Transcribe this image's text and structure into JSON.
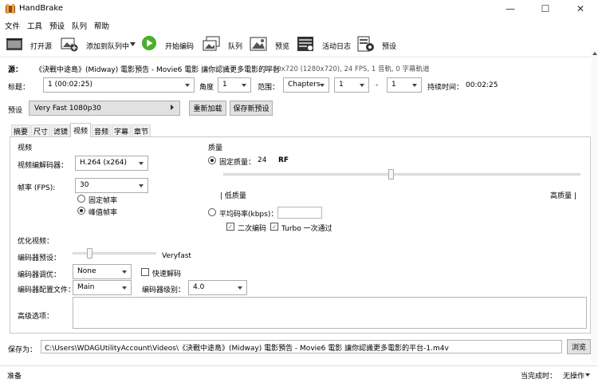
{
  "window": {
    "title": "HandBrake",
    "minimize": "—",
    "maximize": "☐",
    "close": "✕"
  },
  "menu": [
    "文件",
    "工具",
    "预设",
    "队列",
    "帮助"
  ],
  "toolbar": {
    "open": "打开源",
    "add_queue": "添加到队列中",
    "start": "开始编码",
    "queue": "队列",
    "preview": "预览",
    "activity": "活动日志",
    "presets": "预设"
  },
  "source": {
    "label": "源：",
    "name": "《決戰中途島》(Midway) 電影預告 - Movie6 電影 讓你認識更多電影的平台",
    "info": "1280x720 (1280x720), 24 FPS, 1 音軌, 0 字幕軌道"
  },
  "title_row": {
    "label": "标题：",
    "title_value": "1 (00:02:25)",
    "angle_label": "角度",
    "angle_value": "1",
    "range_label": "范围：",
    "range_type": "Chapters",
    "range_start": "1",
    "dash": "-",
    "range_end": "1",
    "duration_label": "持续时间：",
    "duration_value": "00:02:25"
  },
  "preset_row": {
    "label": "预设",
    "preset_value": "Very Fast 1080p30",
    "reload": "重新加载",
    "save_new": "保存新预设"
  },
  "tabs": [
    "摘要",
    "尺寸",
    "滤镜",
    "视频",
    "音频",
    "字幕",
    "章节"
  ],
  "video": {
    "section": "视频",
    "encoder_label": "视频编解码器：",
    "encoder_value": "H.264 (x264)",
    "fps_label": "帧率 (FPS):",
    "fps_value": "30",
    "cfr": "固定帧率",
    "pfr": "峰值帧率",
    "quality_section": "质量",
    "cq_label": "固定质量：",
    "cq_value": "24",
    "rf": "RF",
    "low_q": "| 低质量",
    "high_q": "高质量 |",
    "abr_label": "平均码率(kbps)：",
    "abr_value": "",
    "twopass": "二次编码",
    "turbo": "Turbo 一次通过",
    "opt_section": "优化视频：",
    "enc_preset_label": "编码器预设：",
    "enc_preset_value": "Veryfast",
    "tune_label": "编码器调优：",
    "tune_value": "None",
    "fast_decode": "快速解码",
    "profile_label": "编码器配置文件：",
    "profile_value": "Main",
    "level_label": "编码器级别：",
    "level_value": "4.0",
    "advanced_label": "高级选项：",
    "advanced_value": ""
  },
  "quality_slider_fraction": 0.47,
  "preset_slider_fraction": 0.2,
  "save": {
    "label": "保存为：",
    "path": "C:\\Users\\WDAGUtilityAccount\\Videos\\《決戰中途島》(Midway) 電影預告 - Movie6 電影 讓你認識更多電影的平台-1.m4v",
    "browse": "浏览"
  },
  "status": {
    "left": "准备",
    "when_done_label": "当完成时：",
    "when_done_value": "无操作"
  },
  "colors": {
    "accent": "#4caf2b",
    "window_bg": "#ffffff",
    "panel_border": "#c9c9c9"
  }
}
